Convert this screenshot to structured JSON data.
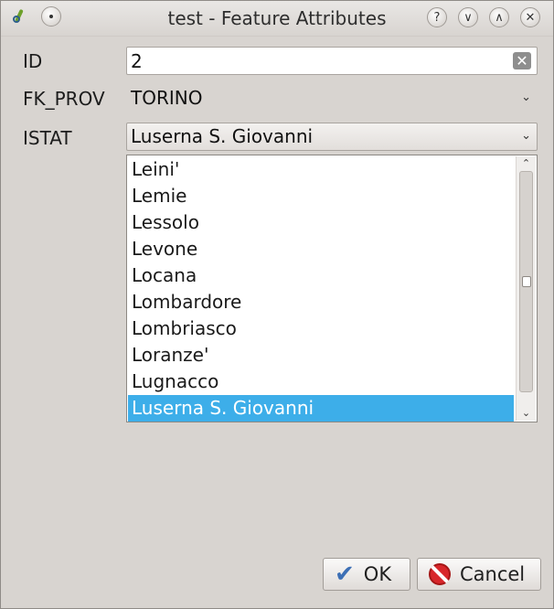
{
  "window": {
    "title": "test - Feature Attributes"
  },
  "form": {
    "id_label": "ID",
    "id_value": "2",
    "prov_label": "FK_PROV",
    "prov_value": "TORINO",
    "istat_label": "ISTAT",
    "istat_value": "Luserna S. Giovanni"
  },
  "dropdown": {
    "items": [
      "Leini'",
      "Lemie",
      "Lessolo",
      "Levone",
      "Locana",
      "Lombardore",
      "Lombriasco",
      "Loranze'",
      "Lugnacco",
      "Luserna S. Giovanni"
    ],
    "selected_index": 9,
    "scroll_fraction": 0.5
  },
  "buttons": {
    "ok_label": "OK",
    "cancel_label": "Cancel"
  },
  "colors": {
    "selection": "#3daee9",
    "window_bg": "#d8d4d0"
  }
}
